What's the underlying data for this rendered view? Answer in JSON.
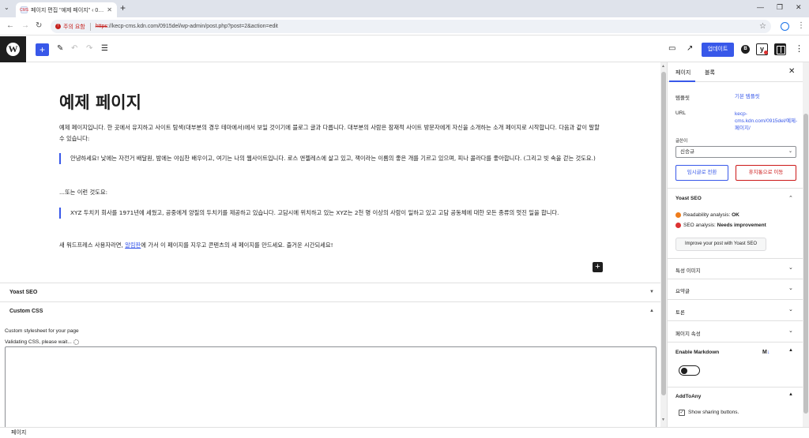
{
  "browser": {
    "tab_title": "페이지 편집 \"예제 페이지\" ‹ 0…",
    "tab_favicon": "CMS",
    "url_warning": "주의 요함",
    "url_scheme": "https",
    "url_rest": "://kecp-cms.kdn.com/0915del/wp-admin/post.php?post=2&action=edit"
  },
  "toolbar": {
    "add_label": "+",
    "update_label": "업데이트",
    "icons": [
      "pencil-icon",
      "undo-icon",
      "redo-icon",
      "list-view-icon",
      "preview-icon",
      "external-link-icon",
      "jetpack-b-icon",
      "yoast-icon",
      "settings-icon",
      "options-icon"
    ]
  },
  "post": {
    "title": "예제 페이지",
    "intro": "예제 페이지입니다. 한 곳에서 유지하고 사이트 탐색(대부분의 경우 테마에서)에서 보일 것이기에 블로그 글과 다릅니다. 대부분의 사람은 잠재적 사이트 방문자에게 자신을 소개하는 소개 페이지로 시작합니다. 다음과 같이 말할 수 있습니다:",
    "quote1": "안녕하세요! 낮에는 자전거 배달원, 밤에는 야심찬 배우이고, 여기는 나의 웹사이트입니다. 로스 앤젤레스에 살고 있고, 잭이라는 이름의 좋은 개를 기르고 있으며, 피나 콜라다를 좋아합니다. (그리고 빗 속을 걷는 것도요.)",
    "middle": "...또는 이런 것도요:",
    "quote2": "XYZ 두치키 회사를 1971년에 세웠고, 공중에게 양질의 두치키를 제공하고 있습니다. 고담시에 위치하고 있는 XYZ는 2천 명 이상의 사람이 일하고 있고 고담 공동체에 대한 모든 종류의 멋진 일을 합니다.",
    "outro_before": "새 워드프레스 사용자라면, ",
    "outro_link": "알림판",
    "outro_after": "에 가서 이 페이지를 지우고 콘텐츠의 새 페이지를 만드세요. 즐거운 시간되세요!"
  },
  "metaboxes": {
    "yoast_label": "Yoast SEO",
    "css_label": "Custom CSS",
    "css_desc": "Custom stylesheet for your page",
    "css_status": "Validating CSS, please wait..."
  },
  "footer": {
    "breadcrumb": "페이지"
  },
  "sidebar": {
    "tab_page": "페이지",
    "tab_block": "블록",
    "template_label": "템플릿",
    "template_value": "기본 템플릿",
    "url_label": "URL",
    "url_value": "kecp-cms.kdn.com/0915del/예제-페이지/",
    "author_label": "글쓴이",
    "author_value": "신승규",
    "draft_btn": "임시글로 전환",
    "trash_btn": "휴지통으로 이동",
    "yoast_title": "Yoast SEO",
    "readability_label": "Readability analysis: ",
    "readability_value": "OK",
    "seo_label": "SEO analysis: ",
    "seo_value": "Needs improvement",
    "yoast_btn": "Improve your post with Yoast SEO",
    "featured_image": "특성 이미지",
    "excerpt": "요약글",
    "discussion": "토론",
    "page_attributes": "페이지 속성",
    "markdown_title": "Enable Markdown",
    "markdown_badge": "M",
    "addtoany_title": "AddToAny",
    "sharing_label": "Show sharing buttons."
  },
  "colors": {
    "accent": "#3858e9",
    "danger": "#cc1818",
    "wp_dark": "#1e1e1e"
  }
}
